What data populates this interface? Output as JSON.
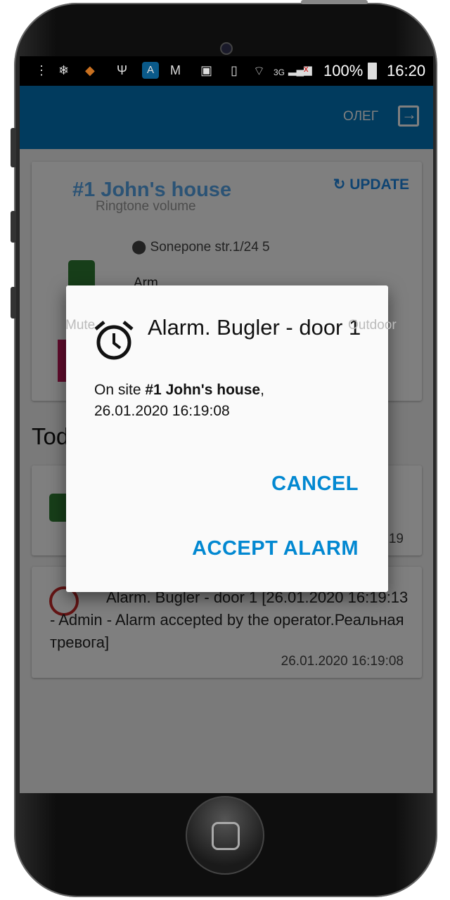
{
  "status_bar": {
    "battery": "100%",
    "time": "16:20",
    "network": "3G",
    "icons": [
      "more-icon",
      "snowflake-icon",
      "shield-phone-icon",
      "usb-icon",
      "app-shield-icon",
      "gmail-icon",
      "image-icon",
      "vibrate-icon",
      "wifi-icon",
      "signal-icon",
      "no-sim-icon",
      "battery-icon"
    ]
  },
  "app_bar": {
    "user": "ОЛЕГ",
    "logout_icon": "logout-icon",
    "color": "#0277bd"
  },
  "site_card": {
    "title": "#1 John's house",
    "update_label": "UPDATE",
    "address": "Sonepone str.1/24 5",
    "arm_label": "Arm"
  },
  "volume_panel": {
    "title": "Ringtone volume",
    "modes": [
      "Mute",
      "Outdoor"
    ]
  },
  "events": {
    "heading": "Today",
    "items": [
      {
        "icon": "lock-icon",
        "color": "#2e7d32",
        "time": "19"
      },
      {
        "icon": "alarm-icon",
        "color": "#c62828",
        "text": "Alarm. Bugler - door 1 [26.01.2020 16:19:13 - Admin - Alarm accepted by the operator.Реальная тревога]",
        "time": "26.01.2020 16:19:08"
      }
    ]
  },
  "dialog": {
    "title": "Alarm. Bugler - door 1",
    "body_prefix": "On site ",
    "site": "#1 John's house",
    "body_suffix": ",",
    "datetime": "26.01.2020 16:19:08",
    "cancel": "CANCEL",
    "accept": "ACCEPT ALARM",
    "accent": "#0288d1"
  }
}
